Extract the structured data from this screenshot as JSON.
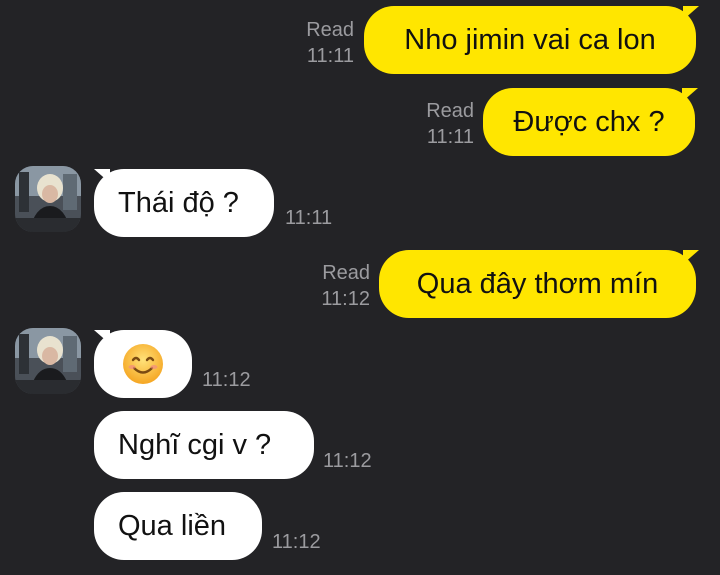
{
  "messages": [
    {
      "id": "m1",
      "direction": "out",
      "text": "Nho jimin vai ca lon",
      "status": "Read",
      "time": "11:11"
    },
    {
      "id": "m2",
      "direction": "out",
      "text": "Được chx ?",
      "status": "Read",
      "time": "11:11"
    },
    {
      "id": "m3",
      "direction": "in",
      "text": "Thái độ ?",
      "time": "11:11"
    },
    {
      "id": "m4",
      "direction": "out",
      "text": "Qua đây thơm mín",
      "status": "Read",
      "time": "11:12"
    },
    {
      "id": "m5",
      "direction": "in",
      "text": "😊",
      "time": "11:12"
    },
    {
      "id": "m6",
      "direction": "in",
      "text": "Nghĩ cgi v ?",
      "time": "11:12"
    },
    {
      "id": "m7",
      "direction": "in",
      "text": "Qua liền",
      "time": "11:12"
    }
  ],
  "colors": {
    "background": "#232326",
    "outgoing_bubble": "#FFE600",
    "incoming_bubble": "#FFFFFF",
    "meta_text": "#9B9B9F"
  }
}
